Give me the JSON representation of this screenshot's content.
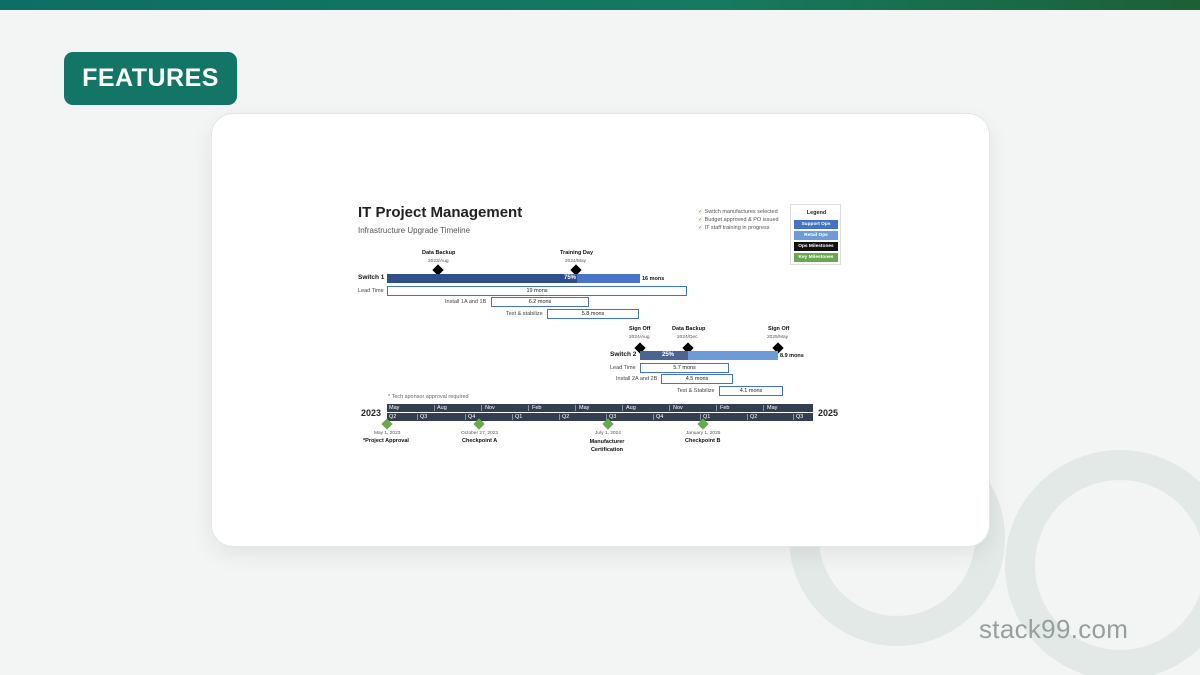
{
  "badge": "FEATURES",
  "brand": "stack99.com",
  "doc": {
    "title": "IT Project Management",
    "subtitle": "Infrastructure Upgrade Timeline"
  },
  "checklist": [
    "Switch manufactures selected",
    "Budget approved & PO issued",
    "IT staff training in progress"
  ],
  "legend": {
    "title": "Legend",
    "items": [
      {
        "label": "Support Ops",
        "color": "#4472c4"
      },
      {
        "label": "Retail Ops",
        "color": "#6d9bd8"
      },
      {
        "label": "Ops Milestones",
        "color": "#111111"
      },
      {
        "label": "Key Milestones",
        "color": "#6aa84f"
      }
    ]
  },
  "switch1": {
    "label": "Switch 1",
    "progress": "75%",
    "duration": "16 mons",
    "milestones": [
      {
        "name": "Data Backup",
        "date": "2023/Aug"
      },
      {
        "name": "Training Day",
        "date": "2024/May"
      }
    ],
    "tasks": [
      {
        "label": "Lead Time",
        "value": "19 mons"
      },
      {
        "label": "Install 1A and 1B",
        "value": "6.2 mons"
      },
      {
        "label": "Test & stabilize",
        "value": "5.8 mons"
      }
    ]
  },
  "switch2": {
    "label": "Switch 2",
    "progress": "25%",
    "duration": "8.9 mons",
    "milestones": [
      {
        "name": "Sign Off",
        "date": "2024/Aug"
      },
      {
        "name": "Data Backup",
        "date": "2024/Dec"
      },
      {
        "name": "Sign Off",
        "date": "2025/May"
      }
    ],
    "tasks": [
      {
        "label": "Lead Time",
        "value": "5.7 mons"
      },
      {
        "label": "Install 2A and 2B",
        "value": "4.5 mons"
      },
      {
        "label": "Test & Stabilize",
        "value": "4.1 mons"
      }
    ]
  },
  "timeline": {
    "note": "* Tech sponsor approval required",
    "start_year": "2023",
    "end_year": "2025",
    "months": [
      "May",
      "Aug",
      "Nov",
      "Feb",
      "May",
      "Aug",
      "Nov",
      "Feb",
      "May"
    ],
    "quarters": [
      "Q2",
      "Q3",
      "Q4",
      "Q1",
      "Q2",
      "Q3",
      "Q4",
      "Q1",
      "Q2",
      "Q3"
    ],
    "key_milestones": [
      {
        "date": "May 1, 2023",
        "name": "*Project Approval"
      },
      {
        "date": "October 27, 2023",
        "name": "Checkpoint A"
      },
      {
        "date": "July 1, 2024",
        "name": "Manufacturer Certification"
      },
      {
        "date": "January 1, 2025",
        "name": "Checkpoint B"
      }
    ]
  }
}
